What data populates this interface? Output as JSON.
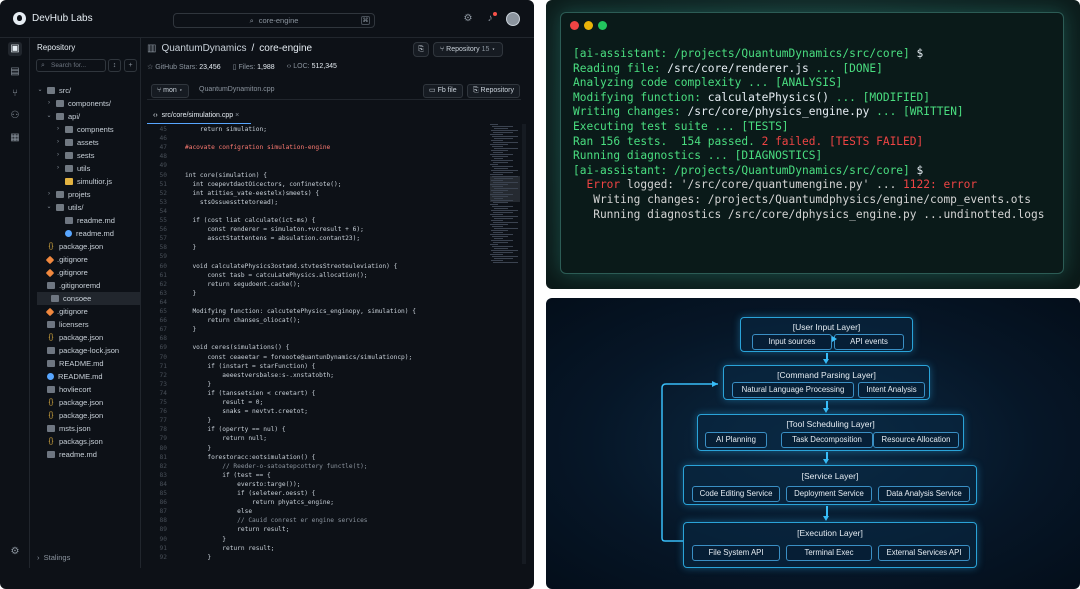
{
  "ide": {
    "brand": "DevHub Labs",
    "search": "core-engine",
    "search_kbd": "⌘",
    "sidebar": {
      "title": "Repository",
      "search_placeholder": "Search for...",
      "footer": "Stalings",
      "tree": [
        {
          "label": "src/",
          "type": "folder",
          "depth": 0,
          "open": true
        },
        {
          "label": "components/",
          "type": "folder",
          "depth": 1
        },
        {
          "label": "api/",
          "type": "folder",
          "depth": 1,
          "open": true
        },
        {
          "label": "compnents",
          "type": "folder",
          "depth": 2
        },
        {
          "label": "assets",
          "type": "folder",
          "depth": 2
        },
        {
          "label": "sests",
          "type": "folder",
          "depth": 2
        },
        {
          "label": "utils",
          "type": "folder",
          "depth": 2
        },
        {
          "label": "simultior.js",
          "type": "js",
          "depth": 2
        },
        {
          "label": "projets",
          "type": "folder",
          "depth": 1
        },
        {
          "label": "utils/",
          "type": "folder",
          "depth": 1,
          "open": true
        },
        {
          "label": "readme.md",
          "type": "txt",
          "depth": 2
        },
        {
          "label": "readme.md",
          "type": "md",
          "depth": 2
        },
        {
          "label": "package.json",
          "type": "json",
          "depth": 0
        },
        {
          "label": ".gitignore",
          "type": "git",
          "depth": 0
        },
        {
          "label": ".gitignore",
          "type": "git",
          "depth": 0
        },
        {
          "label": ".gitignoremd",
          "type": "txt",
          "depth": 0
        },
        {
          "label": "consoee",
          "type": "txt",
          "depth": 0,
          "selected": true
        },
        {
          "label": ".gitignore",
          "type": "git",
          "depth": 0
        },
        {
          "label": "licensers",
          "type": "txt",
          "depth": 0
        },
        {
          "label": "package.json",
          "type": "json",
          "depth": 0
        },
        {
          "label": "package-lock.json",
          "type": "txt",
          "depth": 0
        },
        {
          "label": "README.md",
          "type": "txt",
          "depth": 0
        },
        {
          "label": "README.md",
          "type": "md",
          "depth": 0
        },
        {
          "label": "hovliecort",
          "type": "txt",
          "depth": 0
        },
        {
          "label": "package.json",
          "type": "json",
          "depth": 0
        },
        {
          "label": "package.json",
          "type": "json",
          "depth": 0
        },
        {
          "label": "msts.json",
          "type": "txt",
          "depth": 0
        },
        {
          "label": "packags.json",
          "type": "json",
          "depth": 0
        },
        {
          "label": "readme.md",
          "type": "txt",
          "depth": 0
        }
      ]
    },
    "repo": {
      "owner": "QuantumDynamics",
      "sep": "/",
      "name": "core-engine",
      "stars_label": "GitHub Stars:",
      "stars": "23,456",
      "files_label": "Files:",
      "files": "1,988",
      "loc_label": "LOC:",
      "loc": "512,345",
      "repo_button": "Repository",
      "repo_count": "15"
    },
    "toolbar": {
      "branch": "mon",
      "crumb": "QuantumDynamiton.cpp",
      "find_file": "Fb file",
      "repository": "Repository"
    },
    "tab": "src/core/simulation.cpp",
    "code": [
      {
        "n": "45",
        "t": "    return simulation;"
      },
      {
        "n": "46",
        "t": ""
      },
      {
        "n": "47",
        "t": "#acovate configration simulation-engine"
      },
      {
        "n": "48",
        "t": ""
      },
      {
        "n": "49",
        "t": ""
      },
      {
        "n": "50",
        "t": "int core(simulation) {"
      },
      {
        "n": "51",
        "t": "  int coepevtdaotOicectors, confinetote();"
      },
      {
        "n": "52",
        "t": "  int atities_vate-eestelx)smeets) {"
      },
      {
        "n": "53",
        "t": "    stsOssuessttetoread);"
      },
      {
        "n": "54",
        "t": ""
      },
      {
        "n": "55",
        "t": "  if (cost liat calculate(ict-ms) {"
      },
      {
        "n": "56",
        "t": "      const renderer = simulaton.+vcresult + 6);"
      },
      {
        "n": "57",
        "t": "      assctStattentens = absulation.contant23);"
      },
      {
        "n": "58",
        "t": "  }"
      },
      {
        "n": "59",
        "t": ""
      },
      {
        "n": "60",
        "t": "  void calculatePhysics3ostand.stvtesStreoteuleviation) {"
      },
      {
        "n": "61",
        "t": "      const tasb = catcuLatePhysics.allocation();"
      },
      {
        "n": "62",
        "t": "      return segudoent.cacke();"
      },
      {
        "n": "63",
        "t": "  }"
      },
      {
        "n": "64",
        "t": ""
      },
      {
        "n": "65",
        "t": "  Modifying function: calcutetePhysics_enginopy, simulation) {"
      },
      {
        "n": "66",
        "t": "      return chanses_oliocat();"
      },
      {
        "n": "67",
        "t": "  }"
      },
      {
        "n": "68",
        "t": ""
      },
      {
        "n": "69",
        "t": "  void ceres(simulations() {"
      },
      {
        "n": "70",
        "t": "      const ceaeetar = foreoote@uantunDynamics/simulationcp);"
      },
      {
        "n": "71",
        "t": "      if (instart = starFunction) {"
      },
      {
        "n": "72",
        "t": "          aeeestversbalse:s-.xnstatobth;"
      },
      {
        "n": "73",
        "t": "      }"
      },
      {
        "n": "74",
        "t": "      if (tanssetsien < creetart) {"
      },
      {
        "n": "75",
        "t": "          result = 0;"
      },
      {
        "n": "76",
        "t": "          snaks = nevtvt.creetot;"
      },
      {
        "n": "77",
        "t": "      }"
      },
      {
        "n": "78",
        "t": "      if (operrty == nul) {"
      },
      {
        "n": "79",
        "t": "          return null;"
      },
      {
        "n": "80",
        "t": "      }"
      },
      {
        "n": "81",
        "t": "      forestoracc:eotsimulation() {"
      },
      {
        "n": "82",
        "t": "          // Reeder-o-satoatepcottery functle(t);"
      },
      {
        "n": "83",
        "t": "          if (test == {"
      },
      {
        "n": "84",
        "t": "              eversto:targe());"
      },
      {
        "n": "85",
        "t": "              if (seleteer.oesst) {"
      },
      {
        "n": "86",
        "t": "                  return phyatcs_engine;"
      },
      {
        "n": "87",
        "t": "              else"
      },
      {
        "n": "88",
        "t": "              // Cauid conrest er engine services"
      },
      {
        "n": "89",
        "t": "              return result;"
      },
      {
        "n": "90",
        "t": "          }"
      },
      {
        "n": "91",
        "t": "          return result;"
      },
      {
        "n": "92",
        "t": "      }"
      }
    ]
  },
  "terminal": {
    "lines": [
      {
        "parts": [
          {
            "c": "g",
            "t": "[ai-assistant: /projects/QuantumDynamics/src/core] "
          },
          {
            "c": "w",
            "t": "$"
          }
        ]
      },
      {
        "parts": [
          {
            "c": "g",
            "t": "Reading file: "
          },
          {
            "c": "w",
            "t": "/src/core/renderer.js"
          },
          {
            "c": "g",
            "t": " ... [DONE]"
          }
        ]
      },
      {
        "parts": [
          {
            "c": "g",
            "t": "Analyzing code complexity ... [ANALYSIS]"
          }
        ]
      },
      {
        "parts": [
          {
            "c": "g",
            "t": "Modifying function: "
          },
          {
            "c": "w",
            "t": "calculatePhysics()"
          },
          {
            "c": "g",
            "t": " ... [MODIFIED]"
          }
        ]
      },
      {
        "parts": [
          {
            "c": "g",
            "t": "Writing changes: "
          },
          {
            "c": "w",
            "t": "/src/core/physics_engine.py"
          },
          {
            "c": "g",
            "t": " ... [WRITTEN]"
          }
        ]
      },
      {
        "parts": [
          {
            "c": "g",
            "t": "Executing test suite ... [TESTS]"
          }
        ]
      },
      {
        "parts": [
          {
            "c": "g",
            "t": "Ran 156 tests.  154 passed. "
          },
          {
            "c": "r",
            "t": "2 failed. [TESTS FAILED]"
          }
        ]
      },
      {
        "parts": [
          {
            "c": "g",
            "t": "Running diagnostics ... [DIAGNOSTICS]"
          }
        ]
      },
      {
        "parts": [
          {
            "c": "g",
            "t": "[ai-assistant: /projects/QuantumDynamics/src/core] "
          },
          {
            "c": "w",
            "t": "$"
          }
        ]
      },
      {
        "parts": [
          {
            "c": "r",
            "t": "  Error "
          },
          {
            "c": "gy",
            "t": "logged: '/src/core/quantumengine.py' ... "
          },
          {
            "c": "r",
            "t": "1122: error"
          }
        ]
      },
      {
        "parts": [
          {
            "c": "gy",
            "t": "   Writing changes: /projects/Quantumdphysics/engine/comp_events.ots"
          }
        ]
      },
      {
        "parts": [
          {
            "c": "gy",
            "t": "   Running diagnostics /src/core/dphysics_engine.py ...undinotted.logs"
          }
        ]
      }
    ]
  },
  "diagram": {
    "layers": [
      {
        "title": "[User Input Layer]",
        "items": [
          "Input sources",
          "API events"
        ]
      },
      {
        "title": "[Command Parsing Layer]",
        "items": [
          "Natural Language Processing",
          "Intent Analysis"
        ]
      },
      {
        "title": "[Tool Scheduling Layer]",
        "items": [
          "AI Planning",
          "Task Decomposition",
          "Resource Allocation"
        ]
      },
      {
        "title": "[Service Layer]",
        "items": [
          "Code Editing Service",
          "Deployment Service",
          "Data Analysis Service"
        ]
      },
      {
        "title": "[Execution Layer]",
        "items": [
          "File System API",
          "Terminal Exec",
          "External Services API"
        ]
      }
    ]
  }
}
